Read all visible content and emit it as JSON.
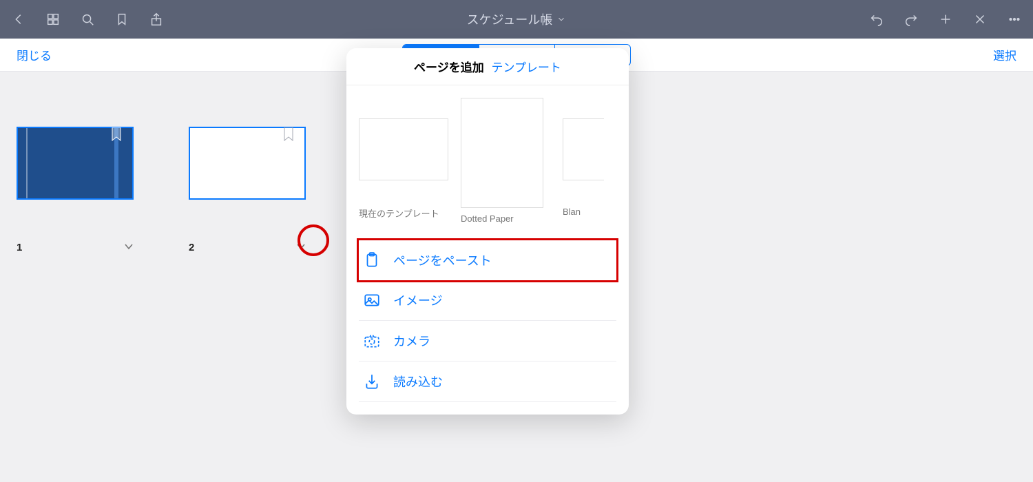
{
  "toolbar": {
    "title": "スケジュール帳"
  },
  "subbar": {
    "close": "閉じる",
    "select": "選択"
  },
  "thumbs": [
    {
      "num": "1"
    },
    {
      "num": "2"
    }
  ],
  "popover": {
    "title": "ページを追加",
    "template_link": "テンプレート",
    "templates": [
      {
        "label": "現在のテンプレート"
      },
      {
        "label": "Dotted Paper"
      },
      {
        "label": "Blan"
      }
    ],
    "items": {
      "paste": "ページをペースト",
      "image": "イメージ",
      "camera": "カメラ",
      "import": "読み込む"
    }
  }
}
